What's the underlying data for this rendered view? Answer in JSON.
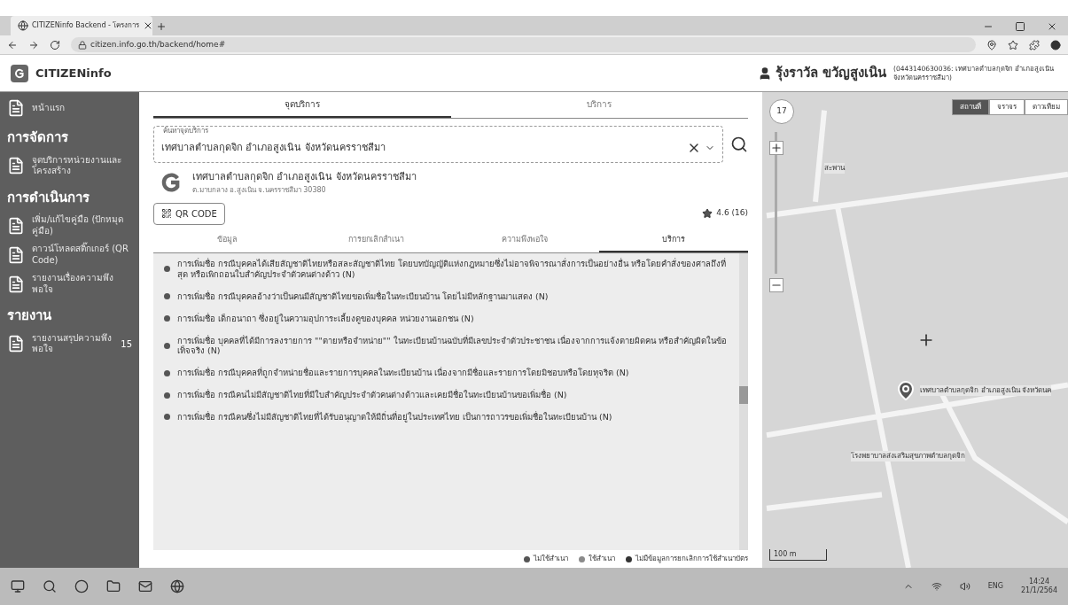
{
  "browser": {
    "tab_title": "CITIZENinfo Backend - โครงการ",
    "url": "citizen.info.go.th/backend/home#"
  },
  "header": {
    "logo": "CITIZENinfo",
    "user_name": "รุ้งราวัล ขวัญสูงเนิน",
    "user_org": "(0443140630036: เทศบาลตำบลกุดจิก อำเภอสูงเนิน จังหวัดนครราชสีมา)"
  },
  "sidebar": {
    "items": [
      {
        "kind": "link",
        "label": "หน้าแรก",
        "selected": false
      },
      {
        "kind": "section",
        "label": "การจัดการ"
      },
      {
        "kind": "link",
        "label": "จุดบริการหน่วยงานและโครงสร้าง",
        "selected": false
      },
      {
        "kind": "section",
        "label": "การดำเนินการ"
      },
      {
        "kind": "link",
        "label": "เพิ่ม/แก้ไขคู่มือ (ปักหมุดคู่มือ)",
        "selected": false
      },
      {
        "kind": "link",
        "label": "ดาวน์โหลดสติ๊กเกอร์ (QR Code)",
        "selected": false
      },
      {
        "kind": "link",
        "label": "รายงานเรื่องความพึงพอใจ",
        "selected": false
      },
      {
        "kind": "section",
        "label": "รายงาน"
      },
      {
        "kind": "link",
        "label": "รายงานสรุปความพึงพอใจ",
        "count": "15",
        "selected": false
      }
    ]
  },
  "top_tabs": [
    {
      "label": "จุดบริการ",
      "selected": true
    },
    {
      "label": "บริการ",
      "selected": false
    }
  ],
  "search": {
    "label": "ค้นหาจุดบริการ",
    "value": "เทศบาลตำบลกุดจิก อำเภอสูงเนิน จังหวัดนครราชสีมา"
  },
  "office": {
    "name": "เทศบาลตำบลกุดจิก อำเภอสูงเนิน จังหวัดนครราชสีมา",
    "address": "ต.มาบกลาง อ.สูงเนิน จ.นครราชสีมา 30380",
    "rating": "4.6 (16)",
    "qr_button": "QR CODE"
  },
  "sub_tabs": [
    {
      "label": "ข้อมูล",
      "selected": false
    },
    {
      "label": "การยกเลิกสำเนา",
      "selected": false
    },
    {
      "label": "ความพึงพอใจ",
      "selected": false
    },
    {
      "label": "บริการ",
      "selected": true
    }
  ],
  "services": [
    {
      "text": "การเพิ่มชื่อ กรณีบุคคลได้เสียสัญชาติไทยหรือสละสัญชาติไทย โดยบทบัญญัติแห่งกฎหมายซึ่งไม่อาจพิจารณาสั่งการเป็นอย่างอื่น หรือโดยคำสั่งของศาลถึงที่สุด หรือเพิกถอนใบสำคัญประจำตัวคนต่างด้าว (N)",
      "color": "#555555"
    },
    {
      "text": "การเพิ่มชื่อ กรณีบุคคลอ้างว่าเป็นคนมีสัญชาติไทยขอเพิ่มชื่อในทะเบียนบ้าน โดยไม่มีหลักฐานมาแสดง (N)",
      "color": "#555555"
    },
    {
      "text": "การเพิ่มชื่อ เด็กอนาถา ซึ่งอยู่ในความอุปการะเลี้ยงดูของบุคคล หน่วยงานเอกชน (N)",
      "color": "#555555"
    },
    {
      "text": "การเพิ่มชื่อ บุคคลที่ได้มีการลงรายการ \"\"ตายหรือจำหน่าย\"\" ในทะเบียนบ้านฉบับที่มีเลขประจำตัวประชาชน เนื่องจากการแจ้งตายผิดคน หรือสำคัญผิดในข้อเท็จจริง (N)",
      "color": "#555555"
    },
    {
      "text": "การเพิ่มชื่อ กรณีบุคคลที่ถูกจำหน่ายชื่อและรายการบุคคลในทะเบียนบ้าน เนื่องจากมีชื่อและรายการโดยมิชอบหรือโดยทุจริต (N)",
      "color": "#555555"
    },
    {
      "text": "การเพิ่มชื่อ กรณีคนไม่มีสัญชาติไทยที่มีใบสำคัญประจำตัวคนต่างด้าวและเคยมีชื่อในทะเบียนบ้านขอเพิ่มชื่อ (N)",
      "color": "#555555"
    },
    {
      "text": "การเพิ่มชื่อ กรณีคนซึ่งไม่มีสัญชาติไทยที่ได้รับอนุญาตให้มีถิ่นที่อยู่ในประเทศไทย เป็นการถาวรขอเพิ่มชื่อในทะเบียนบ้าน (N)",
      "color": "#555555"
    }
  ],
  "legend": [
    {
      "label": "ไม่ใช้สำเนา",
      "color": "#555555"
    },
    {
      "label": "ใช้สำเนา",
      "color": "#8a8a8a"
    },
    {
      "label": "ไม่มีข้อมูลการยกเลิกการใช้สำเนาบัตร",
      "color": "#333333"
    }
  ],
  "map": {
    "zoom": "17",
    "layers": [
      {
        "label": "สถานที่",
        "selected": true
      },
      {
        "label": "จราจร",
        "selected": false
      },
      {
        "label": "ดาวเทียม",
        "selected": false
      }
    ],
    "labels": [
      {
        "kind": "place",
        "text": "สะพาน"
      },
      {
        "kind": "pin",
        "text": "เทศบาลตำบลกุดจิก อำเภอสูงเนิน จังหวัดนค"
      },
      {
        "kind": "poi",
        "text": "โรงพยาบาลส่งเสริมสุขภาพตำบลกุดจิก"
      }
    ],
    "scale": "100 m"
  },
  "taskbar": {
    "language": "ENG",
    "time": "14:24",
    "date": "21/1/2564"
  }
}
